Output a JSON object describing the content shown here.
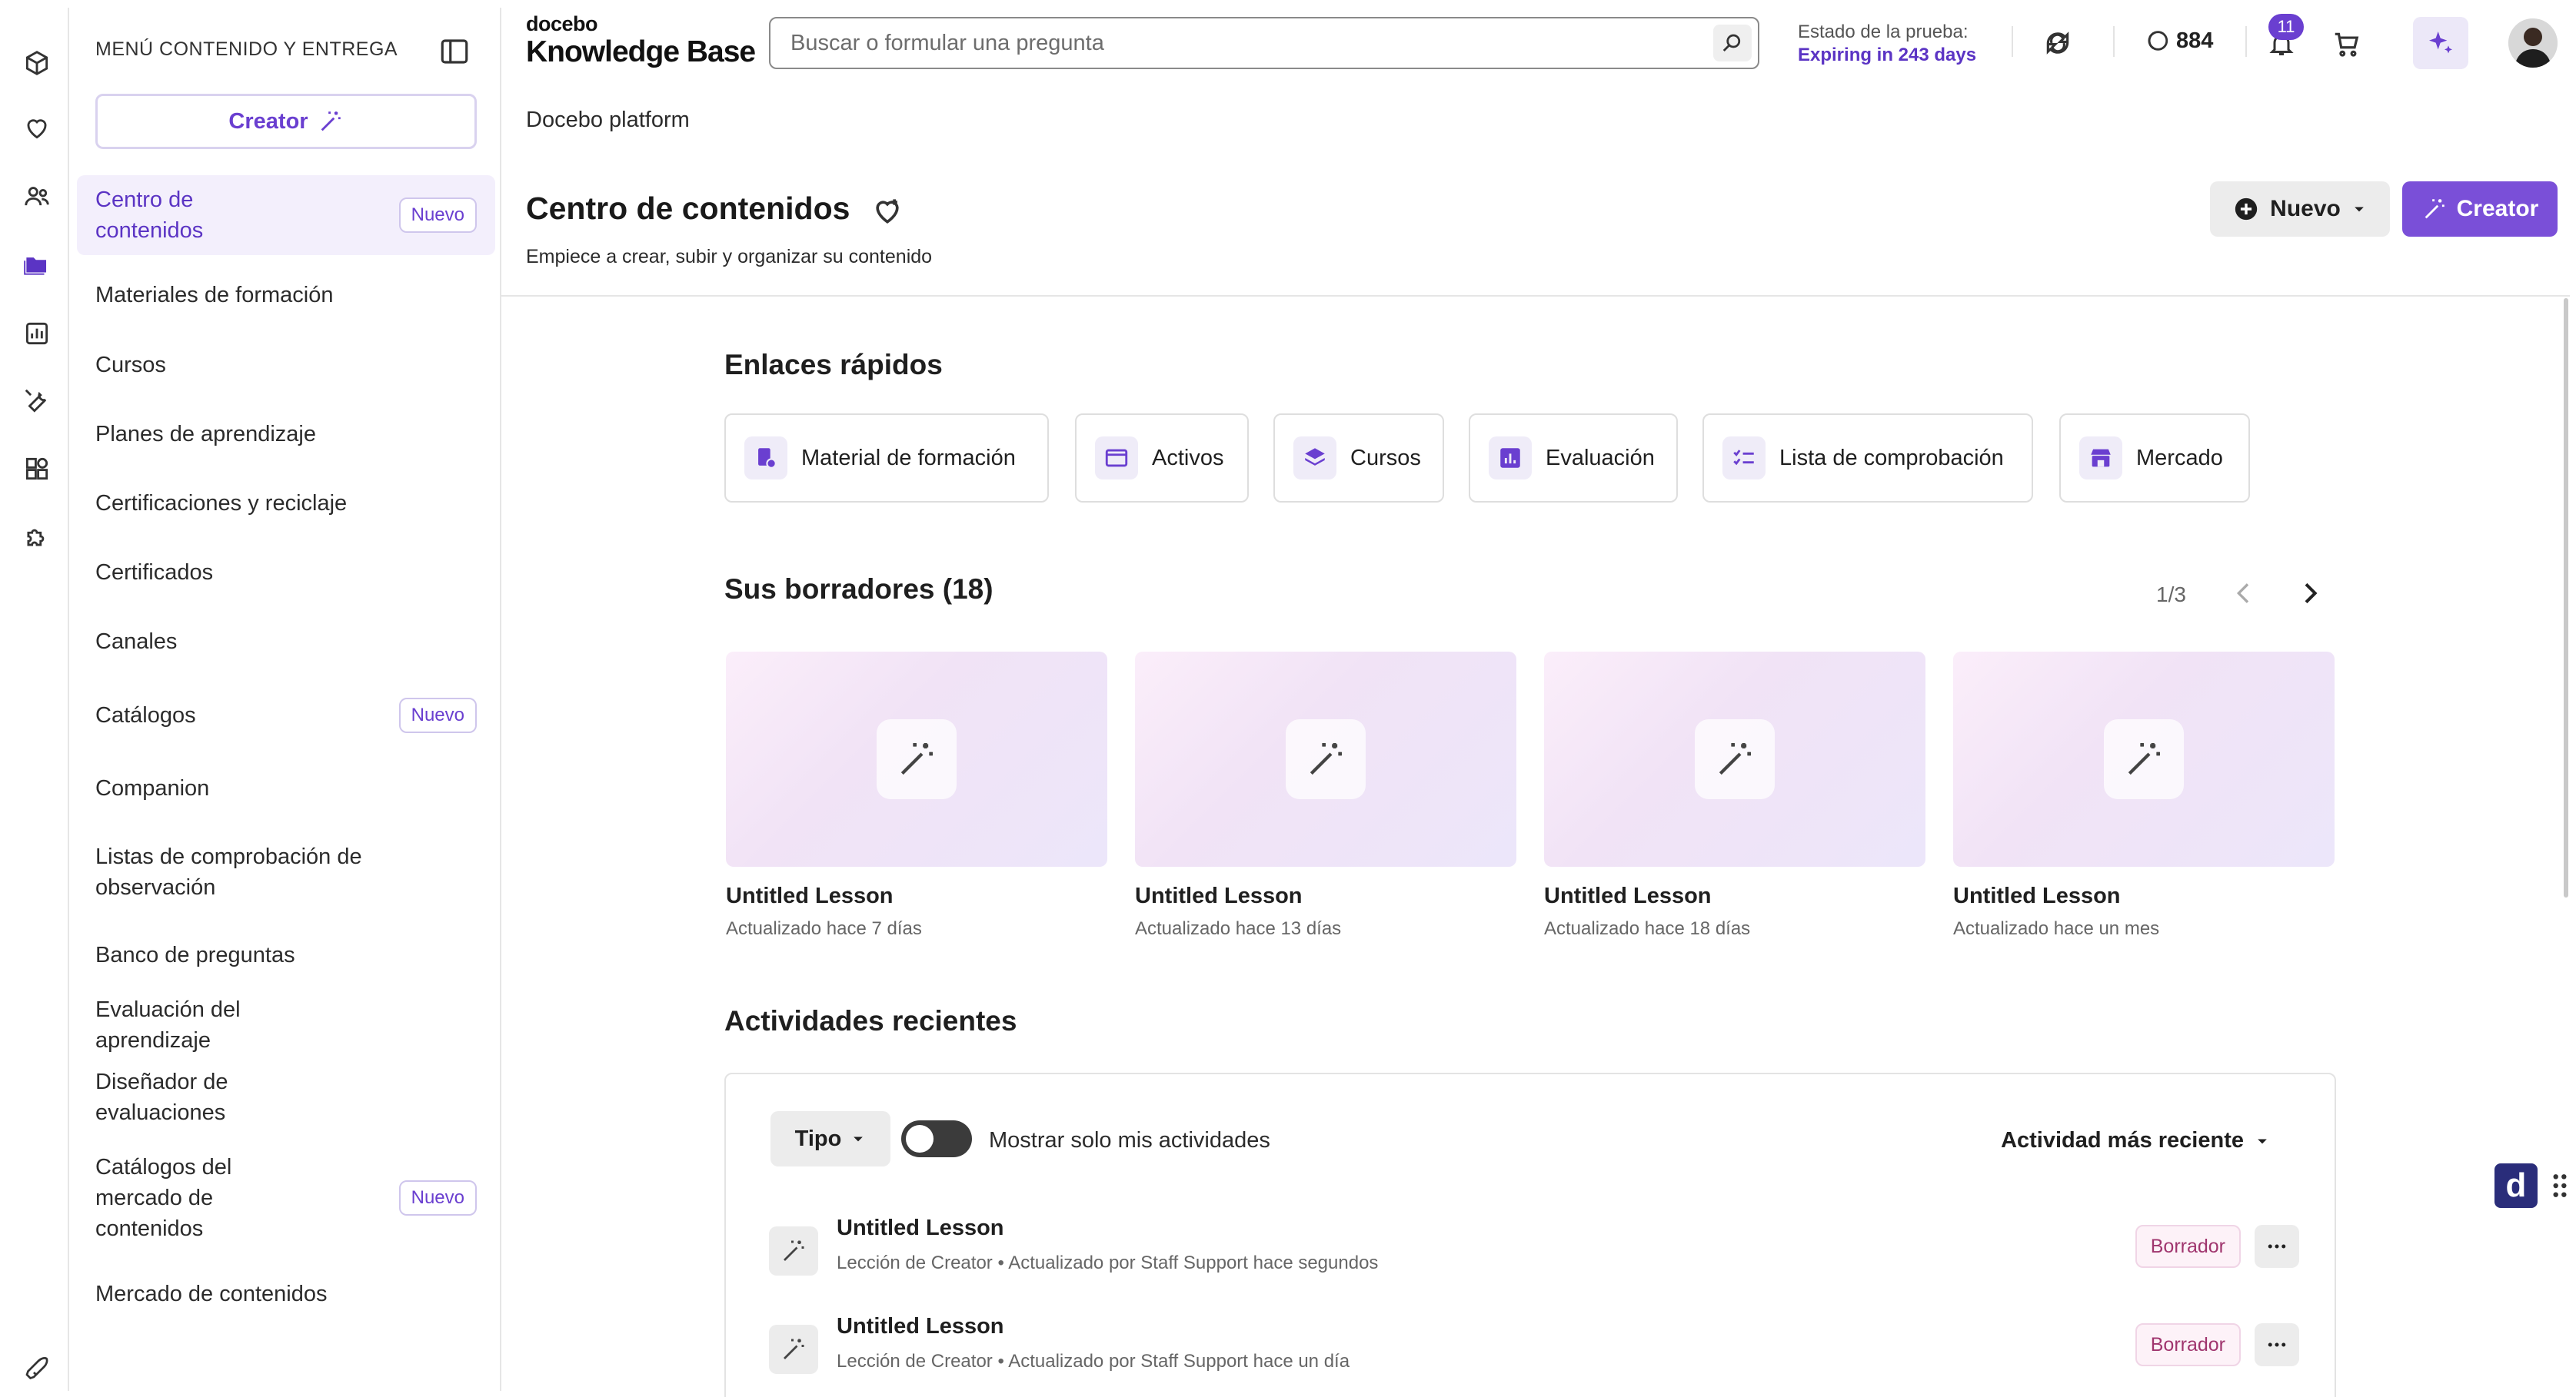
{
  "rail": {
    "icons": [
      "package-icon",
      "heart-icon",
      "people-icon",
      "folder-icon",
      "chart-icon",
      "wrench-icon",
      "apps-icon",
      "puzzle-icon"
    ],
    "active_index": 3,
    "bottom_icon": "rocket-icon"
  },
  "subnav": {
    "header": "MENÚ CONTENIDO Y ENTREGA",
    "creator_label": "Creator",
    "items": [
      {
        "label": "Centro de contenidos",
        "badge": "Nuevo",
        "active": true
      },
      {
        "label": "Materiales de formación"
      },
      {
        "label": "Cursos"
      },
      {
        "label": "Planes de aprendizaje"
      },
      {
        "label": "Certificaciones y reciclaje"
      },
      {
        "label": "Certificados"
      },
      {
        "label": "Canales"
      },
      {
        "label": "Catálogos",
        "badge": "Nuevo"
      },
      {
        "label": "Companion"
      },
      {
        "label": "Listas de comprobación de observación"
      },
      {
        "label": "Banco de preguntas"
      },
      {
        "label": "Evaluación del aprendizaje"
      },
      {
        "label": "Diseñador de evaluaciones"
      },
      {
        "label": "Catálogos del mercado de contenidos",
        "badge": "Nuevo"
      },
      {
        "label": "Mercado de contenidos"
      }
    ]
  },
  "topbar": {
    "brand_small": "docebo",
    "brand_big": "Knowledge Base",
    "search_placeholder": "Buscar o formular una pregunta",
    "trial_label": "Estado de la prueba:",
    "trial_value": "Expiring in 243 days",
    "coins": "884",
    "notifications": "11"
  },
  "page": {
    "breadcrumb": "Docebo platform",
    "title": "Centro de contenidos",
    "subtitle": "Empiece a crear, subir y organizar su contenido",
    "new_button": "Nuevo",
    "creator_button": "Creator"
  },
  "quick_links": {
    "title": "Enlaces rápidos",
    "items": [
      {
        "label": "Material de formación",
        "icon": "training-material-icon"
      },
      {
        "label": "Activos",
        "icon": "window-icon"
      },
      {
        "label": "Cursos",
        "icon": "layers-icon"
      },
      {
        "label": "Evaluación",
        "icon": "bar-chart-icon"
      },
      {
        "label": "Lista de comprobación",
        "icon": "checklist-icon"
      },
      {
        "label": "Mercado",
        "icon": "store-icon"
      }
    ]
  },
  "drafts": {
    "title": "Sus borradores (18)",
    "pager": "1/3",
    "items": [
      {
        "title": "Untitled Lesson",
        "meta": "Actualizado  hace 7 días"
      },
      {
        "title": "Untitled Lesson",
        "meta": "Actualizado  hace 13 días"
      },
      {
        "title": "Untitled Lesson",
        "meta": "Actualizado  hace 18 días"
      },
      {
        "title": "Untitled Lesson",
        "meta": "Actualizado  hace un mes"
      }
    ]
  },
  "activities": {
    "title": "Actividades recientes",
    "type_filter": "Tipo",
    "toggle_label": "Mostrar solo mis actividades",
    "toggle_on": false,
    "sort_label": "Actividad más reciente",
    "rows": [
      {
        "title": "Untitled Lesson",
        "meta": "Lección de Creator • Actualizado por Staff Support  hace segundos",
        "status": "Borrador"
      },
      {
        "title": "Untitled Lesson",
        "meta": "Lección de Creator • Actualizado por Staff Support  hace un día",
        "status": "Borrador"
      }
    ]
  },
  "floating_widget": {
    "letter": "d"
  },
  "colors": {
    "accent": "#6a3fd0",
    "accent_bg": "#f3effc",
    "draft_status": "#a0356e"
  }
}
